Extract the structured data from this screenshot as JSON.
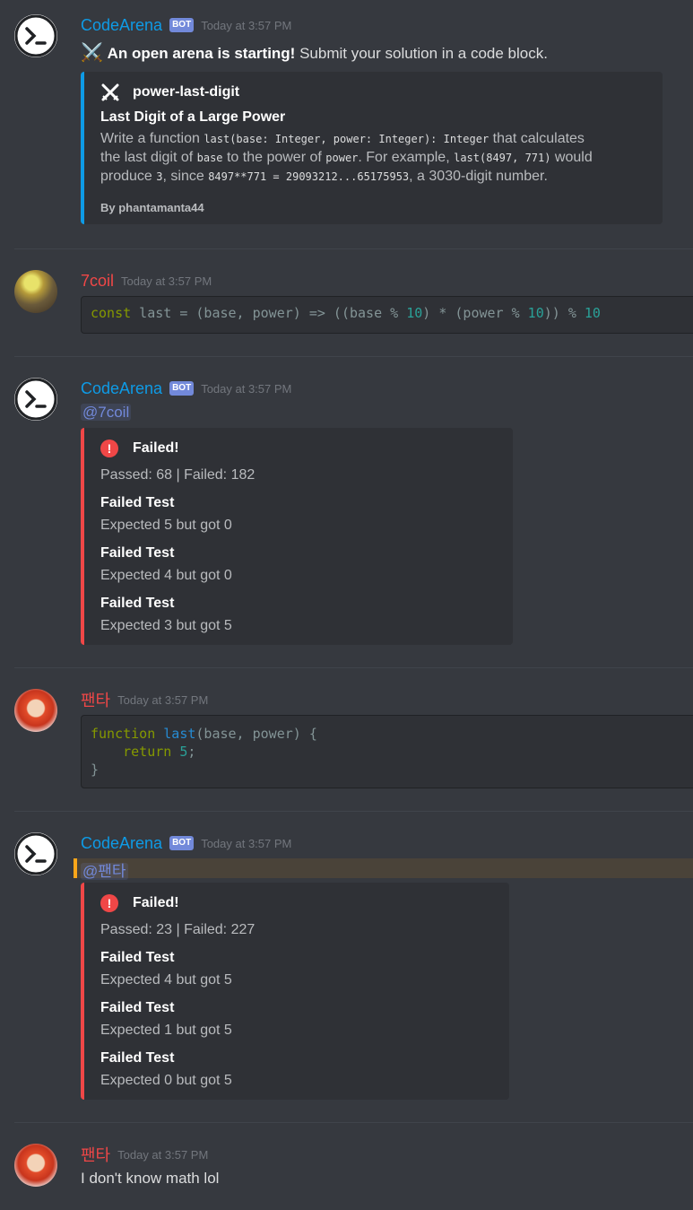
{
  "messages": [
    {
      "author": "CodeArena",
      "bot_badge": "BOT",
      "timestamp": "Today at 3:57 PM",
      "intro_emoji": "⚔️",
      "intro_bold": "An open arena is starting!",
      "intro_rest": " Submit your solution in a code block.",
      "embed": {
        "icon": "crossed-swords-icon",
        "title": "power-last-digit",
        "subtitle": "Last Digit of a Large Power",
        "desc": {
          "p1": "Write a function ",
          "c1": "last(base: Integer, power: Integer): Integer",
          "p2": " that calculates",
          "p3": "the last digit of ",
          "c2": "base",
          "p4": " to the power of ",
          "c3": "power",
          "p5": ". For example, ",
          "c4": "last(8497, 771)",
          "p6": " would",
          "p7": "produce ",
          "c5": "3",
          "p8": ", since ",
          "c6": "8497**771 = 29093212...65175953",
          "p9": ", a 3030-digit number."
        },
        "footer": "By phantamanta44"
      }
    },
    {
      "author": "7coil",
      "timestamp": "Today at 3:57 PM",
      "code": {
        "t1": "const",
        "t2": " last = (base, power) => ((base % ",
        "t3": "10",
        "t4": ") * (power % ",
        "t5": "10",
        "t6": ")) % ",
        "t7": "10"
      }
    },
    {
      "author": "CodeArena",
      "bot_badge": "BOT",
      "timestamp": "Today at 3:57 PM",
      "mention": "@7coil",
      "result": {
        "status": "Failed!",
        "summary": "Passed: 68 | Failed: 182",
        "tests": [
          {
            "title": "Failed Test",
            "detail": "Expected 5 but got 0"
          },
          {
            "title": "Failed Test",
            "detail": "Expected 4 but got 0"
          },
          {
            "title": "Failed Test",
            "detail": "Expected 3 but got 5"
          }
        ]
      }
    },
    {
      "author": "팬타",
      "timestamp": "Today at 3:57 PM",
      "code": {
        "l1a": "function",
        "l1b": " ",
        "l1c": "last",
        "l1d": "(base, power) {",
        "l2a": "    return",
        "l2b": " ",
        "l2c": "5",
        "l2d": ";",
        "l3": "}"
      }
    },
    {
      "author": "CodeArena",
      "bot_badge": "BOT",
      "timestamp": "Today at 3:57 PM",
      "mention": "@팬타",
      "result": {
        "status": "Failed!",
        "summary": "Passed: 23 | Failed: 227",
        "tests": [
          {
            "title": "Failed Test",
            "detail": "Expected 4 but got 5"
          },
          {
            "title": "Failed Test",
            "detail": "Expected 1 but got 5"
          },
          {
            "title": "Failed Test",
            "detail": "Expected 0 but got 5"
          }
        ]
      }
    },
    {
      "author": "팬타",
      "timestamp": "Today at 3:57 PM",
      "text": "I don't know math lol"
    }
  ],
  "colors": {
    "background": "#36393f",
    "bot_name": "#0e9be6",
    "user_name": "#f04747",
    "embed_info": "#0e9be6",
    "embed_fail": "#f04747",
    "mention_highlight": "#faa61a"
  }
}
